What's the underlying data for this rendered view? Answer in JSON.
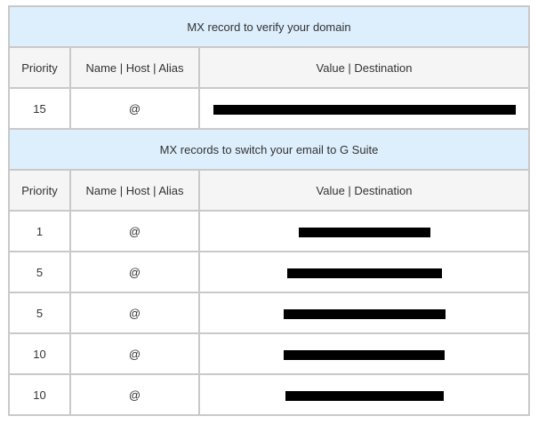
{
  "verify_section": {
    "title": "MX record to verify your domain",
    "headers": {
      "priority": "Priority",
      "name": "Name | Host | Alias",
      "value": "Value | Destination"
    },
    "rows": [
      {
        "priority": "15",
        "name": "@",
        "value": "[redacted]"
      }
    ]
  },
  "switch_section": {
    "title": "MX records to switch your email to G Suite",
    "headers": {
      "priority": "Priority",
      "name": "Name | Host | Alias",
      "value": "Value | Destination"
    },
    "rows": [
      {
        "priority": "1",
        "name": "@",
        "value": "[redacted]"
      },
      {
        "priority": "5",
        "name": "@",
        "value": "[redacted]"
      },
      {
        "priority": "5",
        "name": "@",
        "value": "[redacted]"
      },
      {
        "priority": "10",
        "name": "@",
        "value": "[redacted]"
      },
      {
        "priority": "10",
        "name": "@",
        "value": "[redacted]"
      }
    ]
  }
}
